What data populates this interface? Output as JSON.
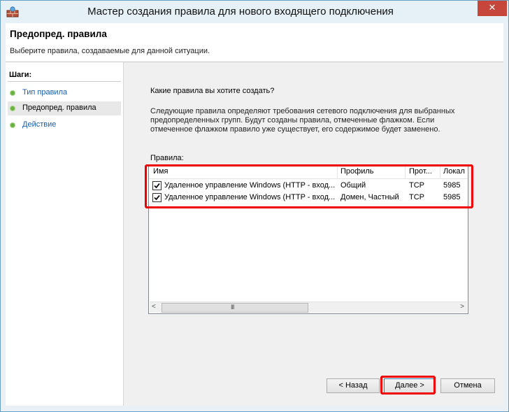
{
  "window": {
    "title": "Мастер создания правила для нового входящего подключения",
    "close_glyph": "✕"
  },
  "header": {
    "title": "Предопред. правила",
    "subtitle": "Выберите правила, создаваемые для данной ситуации."
  },
  "steps": {
    "title": "Шаги:",
    "items": [
      {
        "label": "Тип правила",
        "state": "done"
      },
      {
        "label": "Предопред. правила",
        "state": "current"
      },
      {
        "label": "Действие",
        "state": "pending"
      }
    ]
  },
  "content": {
    "question": "Какие правила вы хотите создать?",
    "description": "Следующие правила определяют требования сетевого подключения для выбранных предопределенных групп. Будут созданы правила, отмеченные флажком. Если отмеченное флажком правило уже существует, его содержимое будет заменено.",
    "rules_label": "Правила:"
  },
  "rules_table": {
    "columns": [
      "Имя",
      "Профиль",
      "Прот...",
      "Локал"
    ],
    "rows": [
      {
        "checked": true,
        "name": "Удаленное управление Windows (HTTP - вход...",
        "profile": "Общий",
        "protocol": "TCP",
        "port": "5985"
      },
      {
        "checked": true,
        "name": "Удаленное управление Windows (HTTP - вход...",
        "profile": "Домен, Частный",
        "protocol": "TCP",
        "port": "5985"
      }
    ],
    "scroll": {
      "left_glyph": "<",
      "right_glyph": ">",
      "grip": "III"
    }
  },
  "buttons": {
    "back": "< Назад",
    "next": "Далее >",
    "cancel": "Отмена"
  },
  "colors": {
    "highlight": "#e00000",
    "link": "#1a5ea8",
    "step_dot": "#6cb243"
  }
}
